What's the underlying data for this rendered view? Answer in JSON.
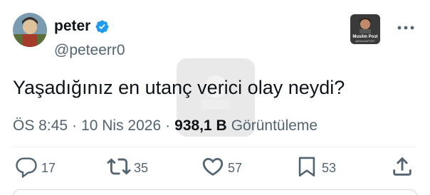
{
  "author": {
    "display_name": "peter",
    "handle": "@peteerr0",
    "verified": true
  },
  "badge": {
    "brand_title": "Muslim Post",
    "brand_handle": "@MuslimPOST"
  },
  "tweet": {
    "text": "Yaşadığınız en utanç verici olay neydi?",
    "time": "ÖS 8:45",
    "date": "10 Nis 2026",
    "separator": "·",
    "views_count": "938,1 B",
    "views_label": "Görüntüleme"
  },
  "actions": {
    "replies": "17",
    "reposts": "35",
    "likes": "57",
    "bookmarks": "53"
  },
  "colors": {
    "verified": "#1d9bf0",
    "text": "#0f1419",
    "muted": "#536471",
    "divider": "#eff3f4"
  },
  "icons": {
    "more": "more-dots-icon",
    "reply": "speech-bubble-icon",
    "repost": "repost-arrows-icon",
    "like": "heart-icon",
    "bookmark": "bookmark-icon",
    "share": "share-upload-icon"
  }
}
